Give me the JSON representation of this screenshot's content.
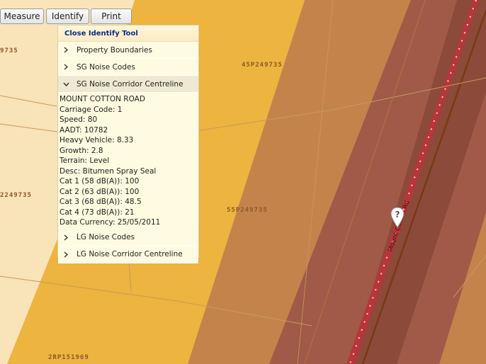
{
  "toolbar": {
    "measure_label": "Measure",
    "identify_label": "Identify",
    "print_label": "Print"
  },
  "map": {
    "labels": {
      "l1": "9735",
      "l2": "45P249735",
      "l3": "2249735",
      "l4": "55P249735",
      "l5": "2RP151969"
    },
    "road_label": "Mount Cotton Rd",
    "colors": {
      "light_parcel": "#f9e3b8",
      "mid_parcel": "#edb43f",
      "brown_zone": "#c4834a",
      "dark_zone": "#a05a47",
      "corridor": "#8c4a3a",
      "road": "#b8353a",
      "centreline": "#7a3a10"
    }
  },
  "panel": {
    "header": "Close Identify Tool",
    "sections": [
      {
        "label": "Property Boundaries"
      },
      {
        "label": "SG Noise Codes"
      },
      {
        "label": "SG Noise Corridor Centreline"
      },
      {
        "label": "LG Noise Codes"
      },
      {
        "label": "LG Noise Corridor Centreline"
      }
    ],
    "details": [
      "MOUNT COTTON ROAD",
      "Carriage Code: 1",
      "Speed: 80",
      "AADT: 10782",
      "Heavy Vehicle: 8.33",
      "Growth: 2.8",
      "Terrain: Level",
      "Desc: Bitumen Spray Seal",
      "Cat 1 (58 dB(A)): 100",
      "Cat 2 (63 dB(A)): 100",
      "Cat 3 (68 dB(A)): 48.5",
      "Cat 4 (73 dB(A)): 21",
      "Data Currency: 25/05/2011"
    ]
  }
}
